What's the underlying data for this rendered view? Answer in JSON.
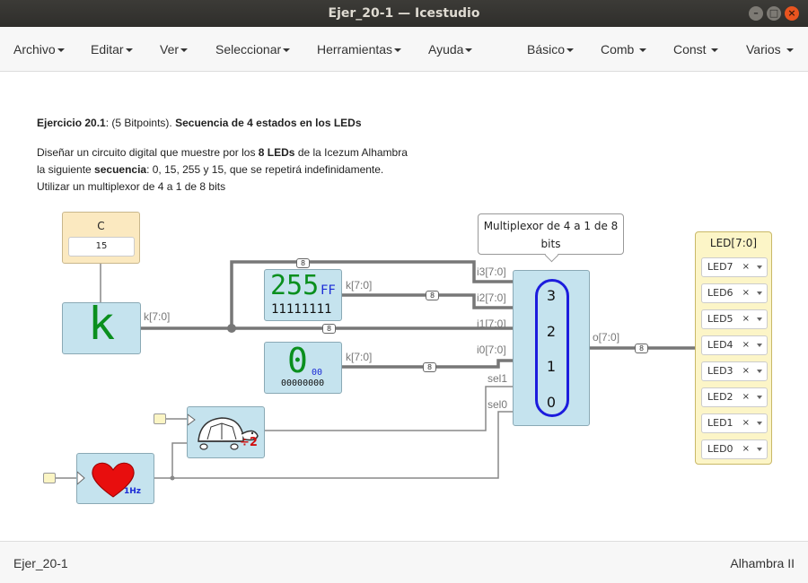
{
  "window": {
    "title": "Ejer_20-1 — Icestudio"
  },
  "menu_left": [
    "Archivo",
    "Editar",
    "Ver",
    "Seleccionar",
    "Herramientas",
    "Ayuda"
  ],
  "menu_right": [
    "Básico",
    "Comb",
    "Const",
    "Varios"
  ],
  "info": {
    "title_bold": "Ejercicio 20.1",
    "title_rest": ": (5 Bitpoints). ",
    "title_bold2": "Secuencia de 4 estados en los LEDs",
    "line1_a": "Diseñar un circuito digital que muestre por los ",
    "line1_b": "8 LEDs",
    "line1_c": " de la Icezum Alhambra",
    "line2_a": "la siguiente ",
    "line2_b": "secuencia",
    "line2_c": ": 0, 15, 255 y 15, que se repetirá indefinidamente.",
    "line3": "Utilizar un multiplexor de 4 a 1 de 8 bits"
  },
  "param": {
    "name": "C",
    "value": "15"
  },
  "k_block": {
    "letter": "k",
    "label": "k[7:0]"
  },
  "const255": {
    "dec": "255",
    "hex": "FF",
    "bin": "11111111",
    "label": "k[7:0]"
  },
  "const0": {
    "dec": "0",
    "hex": "00",
    "bin": "00000000",
    "label": "k[7:0]"
  },
  "tooltip": {
    "line1": "Multiplexor de 4 a 1 de 8",
    "line2": "bits"
  },
  "mux": {
    "inputs": [
      "i3[7:0]",
      "i2[7:0]",
      "i1[7:0]",
      "i0[7:0]",
      "sel1",
      "sel0"
    ],
    "numbers": [
      "3",
      "2",
      "1",
      "0"
    ],
    "output": "o[7:0]"
  },
  "bus_width": "8",
  "prescaler": {
    "label": "÷2"
  },
  "heart": {
    "label": "1Hz"
  },
  "leds": {
    "title": "LED[7:0]",
    "items": [
      "LED7",
      "LED6",
      "LED5",
      "LED4",
      "LED3",
      "LED2",
      "LED1",
      "LED0"
    ],
    "remove_symbol": "×"
  },
  "footer": {
    "left": "Ejer_20-1",
    "right": "Alhambra II"
  }
}
